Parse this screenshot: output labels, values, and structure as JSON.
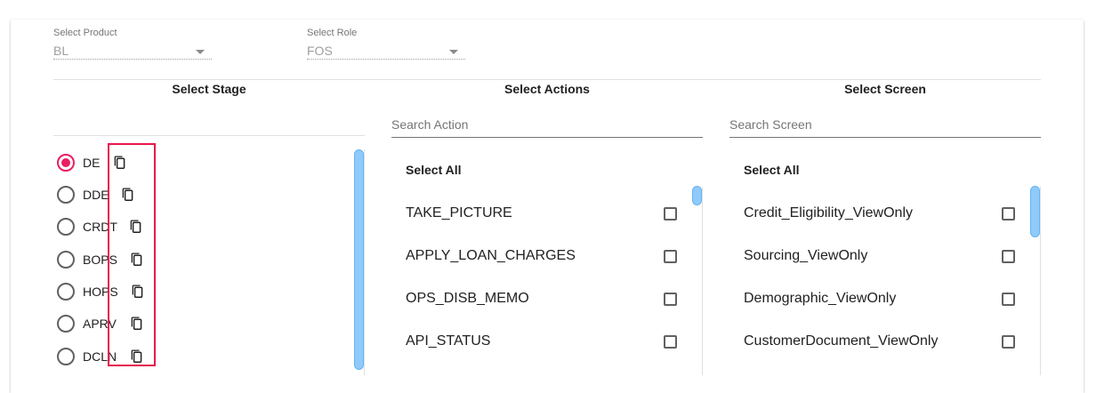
{
  "filters": {
    "product": {
      "label": "Select Product",
      "value": "BL"
    },
    "role": {
      "label": "Select Role",
      "value": "FOS"
    }
  },
  "columns": {
    "stage": {
      "title": "Select Stage"
    },
    "actions": {
      "title": "Select Actions",
      "search_placeholder": "Search Action"
    },
    "screen": {
      "title": "Select Screen",
      "search_placeholder": "Search Screen"
    }
  },
  "stages": [
    {
      "label": "DE",
      "selected": true
    },
    {
      "label": "DDE",
      "selected": false
    },
    {
      "label": "CRDT",
      "selected": false
    },
    {
      "label": "BOPS",
      "selected": false
    },
    {
      "label": "HOPS",
      "selected": false
    },
    {
      "label": "APRV",
      "selected": false
    },
    {
      "label": "DCLN",
      "selected": false
    }
  ],
  "actions": {
    "select_all": "Select All",
    "items": [
      "TAKE_PICTURE",
      "APPLY_LOAN_CHARGES",
      "OPS_DISB_MEMO",
      "API_STATUS"
    ]
  },
  "screens": {
    "select_all": "Select All",
    "items": [
      "Credit_Eligibility_ViewOnly",
      "Sourcing_ViewOnly",
      "Demographic_ViewOnly",
      "CustomerDocument_ViewOnly"
    ]
  },
  "colors": {
    "accent": "#e91e63",
    "highlight": "#e8174b",
    "scroll_thumb": "#90caf9"
  },
  "icons": {
    "copy": "copy-icon",
    "dropdown": "caret-down-icon"
  }
}
